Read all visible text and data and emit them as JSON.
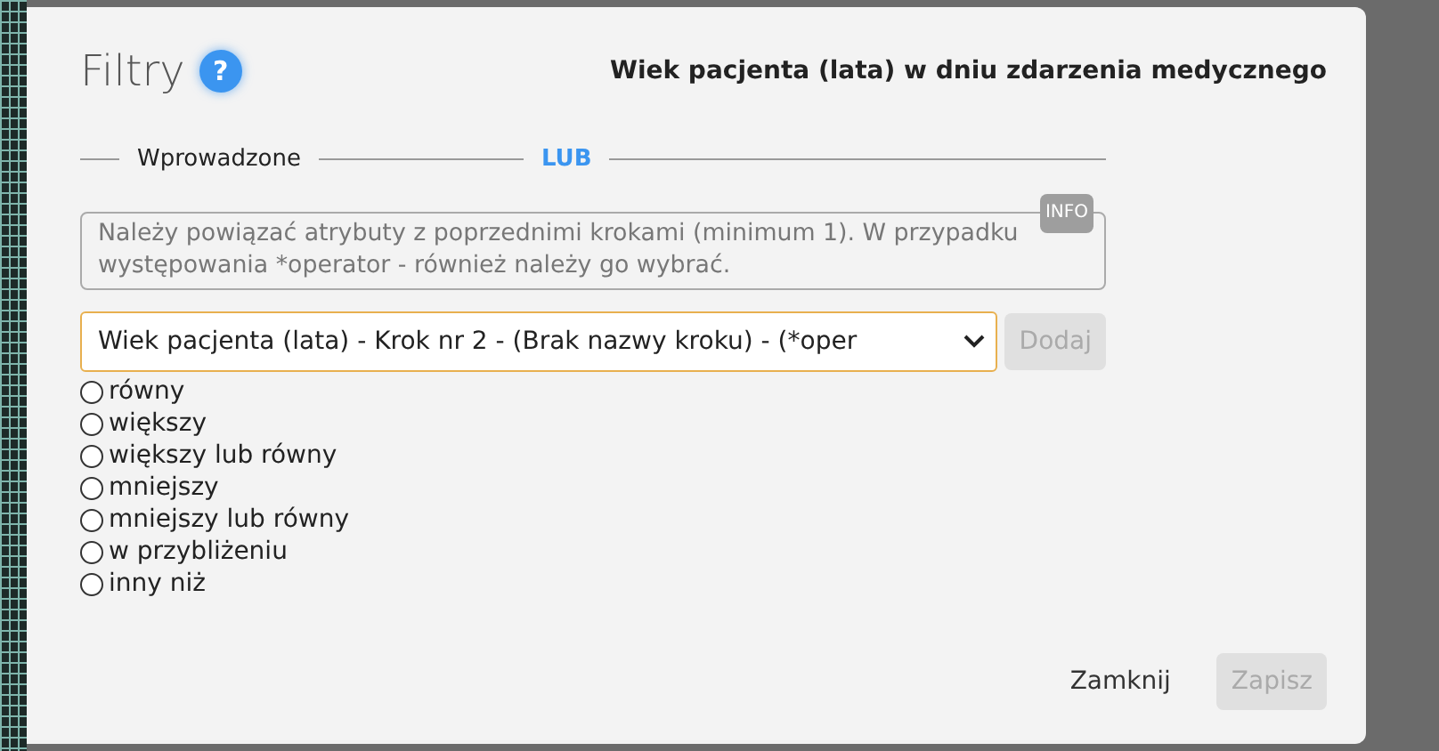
{
  "dialog": {
    "title": "Filtry",
    "help_icon": "?",
    "subtitle": "Wiek pacjenta (lata) w dniu zdarzenia medycznego"
  },
  "tabs": [
    {
      "label": "Wprowadzone",
      "selected": false
    },
    {
      "label": "LUB",
      "selected": true
    }
  ],
  "info": {
    "badge": "INFO",
    "text": "Należy powiązać atrybuty z poprzednimi krokami (minimum 1). W przypadku występowania *operator - również należy go wybrać."
  },
  "attribute_select": {
    "value": "Wiek pacjenta (lata) - Krok nr 2 - (Brak nazwy kroku) - (*oper"
  },
  "add_button": {
    "label": "Dodaj",
    "disabled": true
  },
  "operators": [
    {
      "label": "równy",
      "selected": false
    },
    {
      "label": "większy",
      "selected": false
    },
    {
      "label": "większy lub równy",
      "selected": false
    },
    {
      "label": "mniejszy",
      "selected": false
    },
    {
      "label": "mniejszy lub równy",
      "selected": false
    },
    {
      "label": "w przybliżeniu",
      "selected": false
    },
    {
      "label": "inny niż",
      "selected": false
    }
  ],
  "footer_buttons": [
    {
      "label": "Zamknij",
      "disabled": false
    },
    {
      "label": "Zapisz",
      "disabled": true
    }
  ]
}
